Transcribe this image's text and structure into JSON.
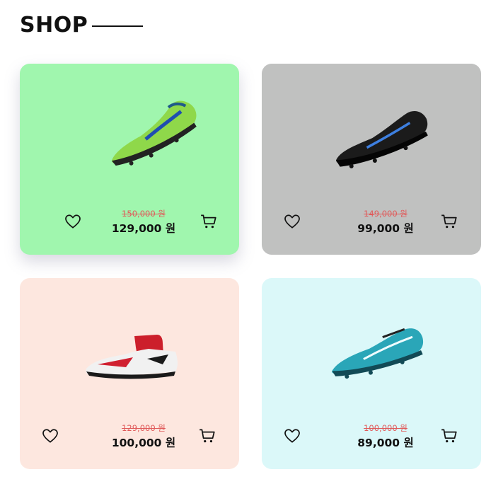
{
  "header": {
    "title": "SHOP"
  },
  "products": [
    {
      "bg": "#a0f6ae",
      "old_price": "150,000 원",
      "new_price": "129,000 원",
      "shoe_color": "lime-green"
    },
    {
      "bg": "#c0c1c0",
      "old_price": "149,000 원",
      "new_price": "99,000 원",
      "shoe_color": "black"
    },
    {
      "bg": "#fde7df",
      "old_price": "129,000 원",
      "new_price": "100,000 원",
      "shoe_color": "red-white"
    },
    {
      "bg": "#dbf8f9",
      "old_price": "100,000 원",
      "new_price": "89,000 원",
      "shoe_color": "teal-blue"
    }
  ],
  "icons": {
    "wishlist": "heart-icon",
    "cart": "shopping-cart-icon"
  }
}
